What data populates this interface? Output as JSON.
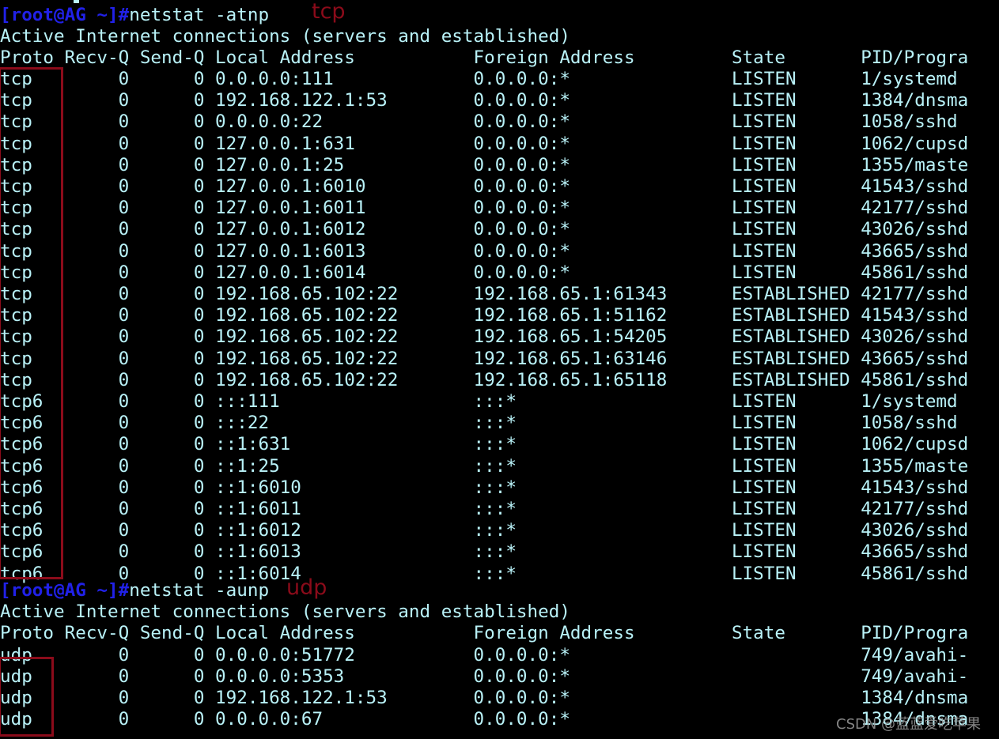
{
  "terminal": {
    "background_color": "#000000",
    "text_color": "#b9f2f8",
    "prompt_color": "#2121e8",
    "annotation_color": "#8b0b1a",
    "char_width": 13.6,
    "line_height": 27.2,
    "prompt": "[root@AG ~]#",
    "blocks": [
      {
        "command": "netstat -atnp",
        "annotation": "tcp",
        "banner": "Active Internet connections (servers and established)",
        "header": "Proto Recv-Q Send-Q Local Address           Foreign Address         State       PID/Progra",
        "rows": [
          "tcp        0      0 0.0.0.0:111             0.0.0.0:*               LISTEN      1/systemd",
          "tcp        0      0 192.168.122.1:53        0.0.0.0:*               LISTEN      1384/dnsma",
          "tcp        0      0 0.0.0.0:22              0.0.0.0:*               LISTEN      1058/sshd",
          "tcp        0      0 127.0.0.1:631           0.0.0.0:*               LISTEN      1062/cupsd",
          "tcp        0      0 127.0.0.1:25            0.0.0.0:*               LISTEN      1355/maste",
          "tcp        0      0 127.0.0.1:6010          0.0.0.0:*               LISTEN      41543/sshd",
          "tcp        0      0 127.0.0.1:6011          0.0.0.0:*               LISTEN      42177/sshd",
          "tcp        0      0 127.0.0.1:6012          0.0.0.0:*               LISTEN      43026/sshd",
          "tcp        0      0 127.0.0.1:6013          0.0.0.0:*               LISTEN      43665/sshd",
          "tcp        0      0 127.0.0.1:6014          0.0.0.0:*               LISTEN      45861/sshd",
          "tcp        0      0 192.168.65.102:22       192.168.65.1:61343      ESTABLISHED 42177/sshd",
          "tcp        0      0 192.168.65.102:22       192.168.65.1:51162      ESTABLISHED 41543/sshd",
          "tcp        0      0 192.168.65.102:22       192.168.65.1:54205      ESTABLISHED 43026/sshd",
          "tcp        0      0 192.168.65.102:22       192.168.65.1:63146      ESTABLISHED 43665/sshd",
          "tcp        0      0 192.168.65.102:22       192.168.65.1:65118      ESTABLISHED 45861/sshd",
          "tcp6       0      0 :::111                  :::*                    LISTEN      1/systemd",
          "tcp6       0      0 :::22                   :::*                    LISTEN      1058/sshd",
          "tcp6       0      0 ::1:631                 :::*                    LISTEN      1062/cupsd",
          "tcp6       0      0 ::1:25                  :::*                    LISTEN      1355/maste",
          "tcp6       0      0 ::1:6010                :::*                    LISTEN      41543/sshd",
          "tcp6       0      0 ::1:6011                :::*                    LISTEN      42177/sshd",
          "tcp6       0      0 ::1:6012                :::*                    LISTEN      43026/sshd",
          "tcp6       0      0 ::1:6013                :::*                    LISTEN      43665/sshd",
          "tcp6       0      0 ::1:6014                :::*                    LISTEN      45861/sshd"
        ]
      },
      {
        "command": "netstat -aunp",
        "annotation": "udp",
        "banner": "Active Internet connections (servers and established)",
        "header": "Proto Recv-Q Send-Q Local Address           Foreign Address         State       PID/Progra",
        "rows": [
          "udp        0      0 0.0.0.0:51772           0.0.0.0:*                           749/avahi-",
          "udp        0      0 0.0.0.0:5353            0.0.0.0:*                           749/avahi-",
          "udp        0      0 192.168.122.1:53        0.0.0.0:*                           1384/dnsma",
          "udp        0      0 0.0.0.0:67              0.0.0.0:*                           1384/dnsma"
        ]
      }
    ]
  },
  "watermark": {
    "text": "CSDN @蓝蓝爱吃苹果"
  }
}
